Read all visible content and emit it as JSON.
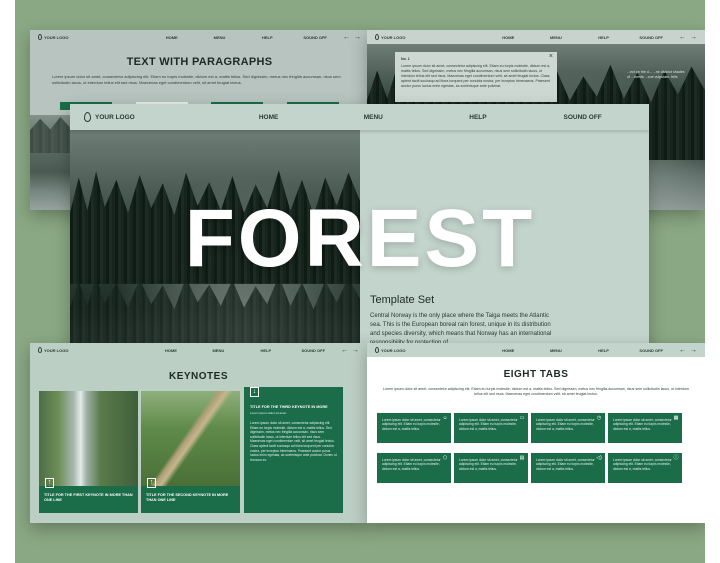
{
  "hero": {
    "title": "FOREST"
  },
  "nav": {
    "logo": "YOUR LOGO",
    "home": "HOME",
    "menu": "MENU",
    "help": "HELP",
    "sound": "SOUND OFF",
    "prev_arrow": "←",
    "next_arrow": "→"
  },
  "slide_paragraphs": {
    "title": "TEXT WITH PARAGRAPHS",
    "body": "Lorem ipsum dolor sit amet, consectetur adipiscing elit. Etiam eu turpis molestie, dictum est a, mattis tellus. Sed dignissim, metus nec fringilla accumsan, risus sem sollicitudin lacus, ut interdum tellus elit sed risus. Maecenas eget condimentum velit, sit amet feugiat lectus."
  },
  "slide_popup": {
    "popup_title": "No. 1",
    "popup_text": "Lorem ipsum dolor sit amet, consectetur adipiscing elit. Etiam eu turpis molestie, dictum est a, mattis tellus. Sed dignissim, metus nec fringilla accumsan, risus sem sollicitudin lacus, ut interdum tellus elit sed risus. Maecenas eget condimentum velit, sit amet feugiat lectus. Class aptent taciti sociosqu ad litora torquent per conubia nostra, per inceptos himenaeos. Praesent auctor purus luctus enim egestas, ac scelerisque ante pulvinar.",
    "close": "×",
    "side_text": "...ect on the d... ...ne distinct shades of ...ments ...cue vulputate, felis"
  },
  "slide_main": {
    "subtitle": "Template Set",
    "body": "Central Norway is the only place where the Taiga meets the Atlantic sea. This is the European boreal rain forest, unique in its distribution and species diversity, which means that Norway has an international responsibility for protection of"
  },
  "slide_keynotes": {
    "title": "KEYNOTES",
    "card1_caption": "TITLE FOR THE FIRST KEYNOTE IN MORE THAN ONE LINE",
    "card2_caption": "TITLE FOR THE SECOND KEYNOTE IN MORE THAN ONE LINE",
    "card3_title": "TITLE FOR THE THIRD KEYNOTE IN MORE",
    "card3_sub": "Lorem ipsum dolor sit amet",
    "card3_text": "Lorem ipsum dolor sit amet, consectetur adipiscing elit. Etiam eu turpis molestie, dictum est a, mattis tellus. Sed dignissim, metus nec fringilla accumsan, risus sem sollicitudin lacus, ut interdum tellus elit sed risus. Maecenas eget condimentum velit, sit amet feugiat lectus. Class aptent taciti sociosqu ad litora torquent per conubia nostra, per inceptos himenaeos. Praesent auctor purus luctus enim egestas, ac scelerisque ante pulvinar. Donec ut rhoncus ex.",
    "up_glyph": "↑",
    "down_glyph": "↓"
  },
  "slide_tabs": {
    "title": "EIGHT TABS",
    "body": "Lorem ipsum dolor sit amet, consectetur adipiscing elit. Etiam eu turpis molestie, dictum est a, mattis tellus. Sed dignissim, metus nec fringilla accumsan, risus sem sollicitudin lacus, ut interdum tellus elit sed risus. Maecenas eget condimentum velit, sit amet feugiat lectus.",
    "tab_text": "Lorem ipsum dolor sit amet, consectetur adipiscing elit. Etiam eu turpis molestie, dictum est a, mattis tellus.",
    "tabs": [
      {
        "icon": "☺"
      },
      {
        "icon": "▭"
      },
      {
        "icon": "◷"
      },
      {
        "icon": "▦"
      },
      {
        "icon": "⬡"
      },
      {
        "icon": "▤"
      },
      {
        "icon": "◁)"
      },
      {
        "icon": "ⓘ"
      }
    ]
  },
  "colors": {
    "canvas": "#8aa883",
    "accent": "#1b6d49",
    "slide_bg": "#c3d4cd"
  }
}
